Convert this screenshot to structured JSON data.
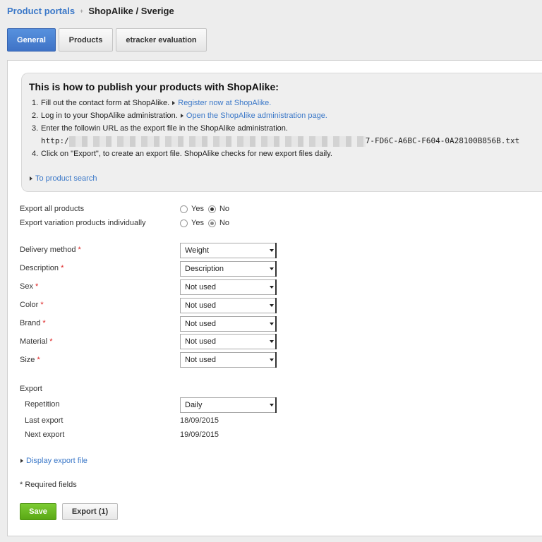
{
  "breadcrumb": {
    "parent": "Product portals",
    "separator": "+",
    "current": "ShopAlike / Sverige"
  },
  "tabs": [
    {
      "label": "General",
      "active": true
    },
    {
      "label": "Products",
      "active": false
    },
    {
      "label": "etracker evaluation",
      "active": false
    }
  ],
  "info": {
    "title": "This is how to publish your products with ShopAlike:",
    "step1_num": "1.",
    "step1_text": "Fill out the contact form at ShopAlike.",
    "step1_link": "Register now at ShopAlike.",
    "step2_num": "2.",
    "step2_text": "Log in to your ShopAlike administration.",
    "step2_link": "Open the ShopAlike administration page.",
    "step3_num": "3.",
    "step3_text": "Enter the followin URL as the export file in the ShopAlike administration.",
    "url_prefix": "http:/",
    "url_suffix": "7-FD6C-A6BC-F604-0A28100B856B.txt",
    "step4_num": "4.",
    "step4_text": "Click on \"Export\", to create an export file. ShopAlike checks for new export files daily.",
    "search_link": "To product search"
  },
  "options": {
    "yes": "Yes",
    "no": "No",
    "export_all_label": "Export all products",
    "variation_label": "Export variation products individually"
  },
  "fields": {
    "required_mark": "*",
    "delivery": {
      "label": "Delivery method",
      "value": "Weight"
    },
    "description": {
      "label": "Description",
      "value": "Description"
    },
    "sex": {
      "label": "Sex",
      "value": "Not used"
    },
    "color": {
      "label": "Color",
      "value": "Not used"
    },
    "brand": {
      "label": "Brand",
      "value": "Not used"
    },
    "material": {
      "label": "Material",
      "value": "Not used"
    },
    "size": {
      "label": "Size",
      "value": "Not used"
    }
  },
  "export": {
    "heading": "Export",
    "repetition_label": "Repetition",
    "repetition_value": "Daily",
    "last_label": "Last export",
    "last_value": "18/09/2015",
    "next_label": "Next export",
    "next_value": "19/09/2015",
    "display_link": "Display export file",
    "required_note": "* Required fields"
  },
  "buttons": {
    "save": "Save",
    "export": "Export (1)"
  },
  "colors": {
    "accent": "#3f73c6",
    "link": "#3b78c8",
    "save": "#5aa815",
    "required": "#dd2222"
  }
}
